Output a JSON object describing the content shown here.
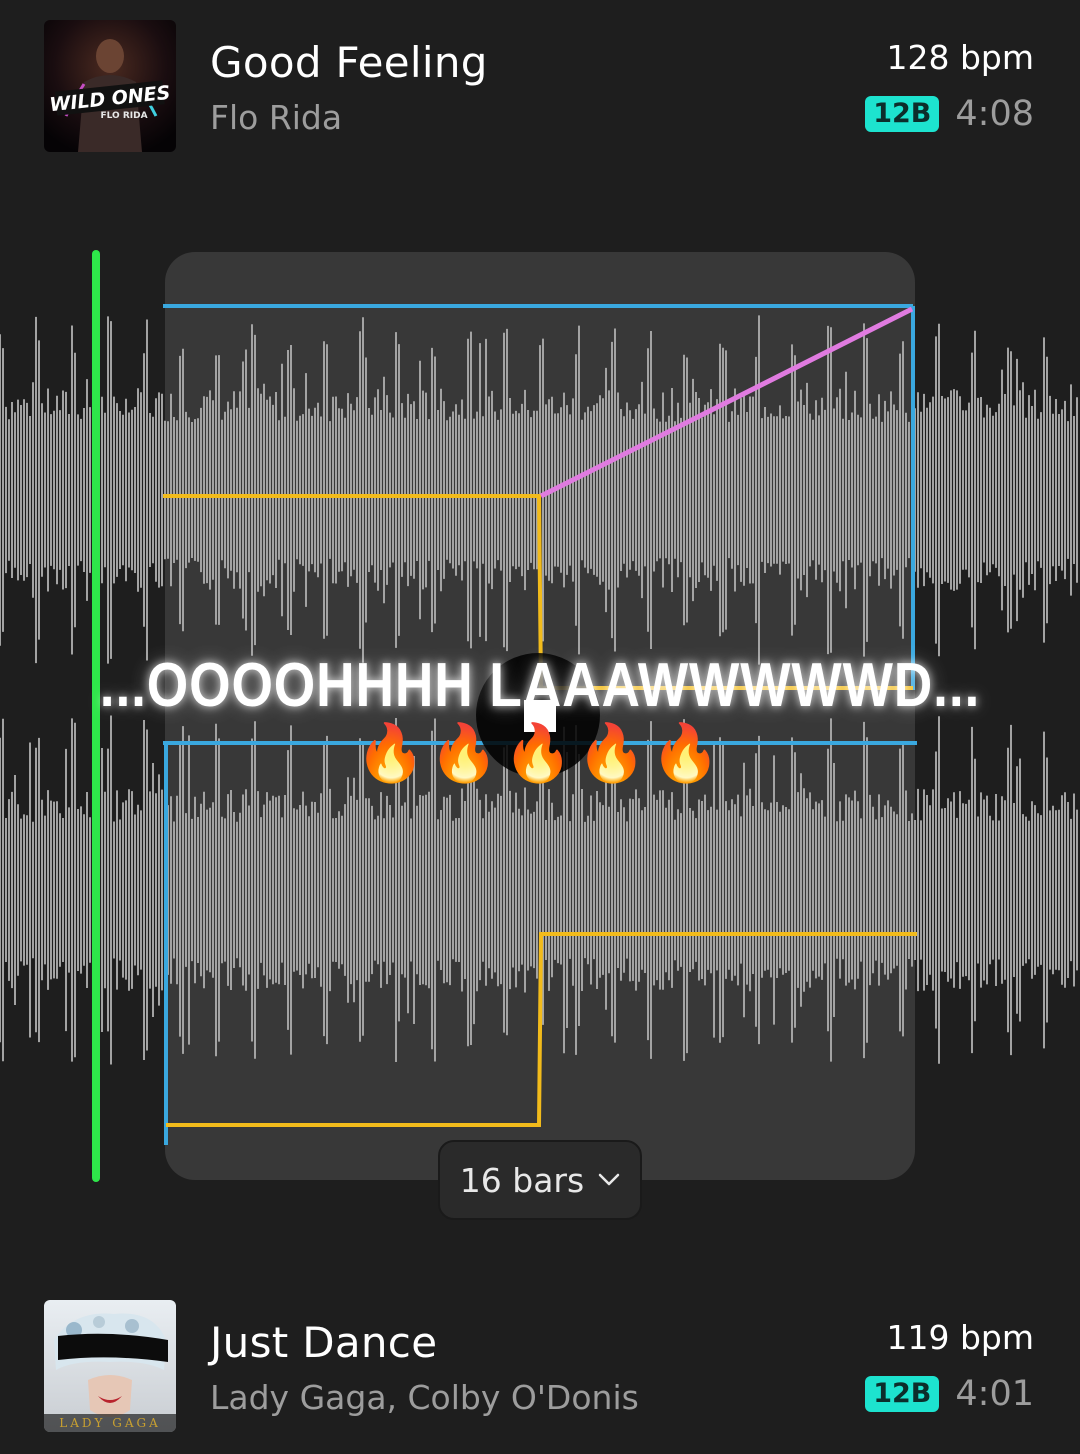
{
  "deck_a": {
    "title": "Good Feeling",
    "artist": "Flo Rida",
    "bpm": "128 bpm",
    "key": "12B",
    "duration": "4:08",
    "artwork_text": "WILD ONES",
    "artwork_subtext": "FLO RIDA"
  },
  "deck_b": {
    "title": "Just Dance",
    "artist": "Lady Gaga, Colby O'Donis",
    "bpm": "119 bpm",
    "key": "12B",
    "duration": "4:01",
    "artwork_text": "LADY GAGA"
  },
  "overlay": {
    "lyric": "...OOOOHHHH LAAAWWWWWD...",
    "emojis": "🔥🔥🔥🔥🔥"
  },
  "transition": {
    "length_label": "16 bars",
    "dropdown_icon": "chevron-down-icon"
  },
  "colors": {
    "background": "#1e1e1e",
    "waveform": "#a3a3a3",
    "playhead": "#2ee64a",
    "volume_curve": "#f2bb1b",
    "region_border": "#3aa8df",
    "effect_curve": "#e07be0",
    "key_badge": "#1de3cf"
  }
}
